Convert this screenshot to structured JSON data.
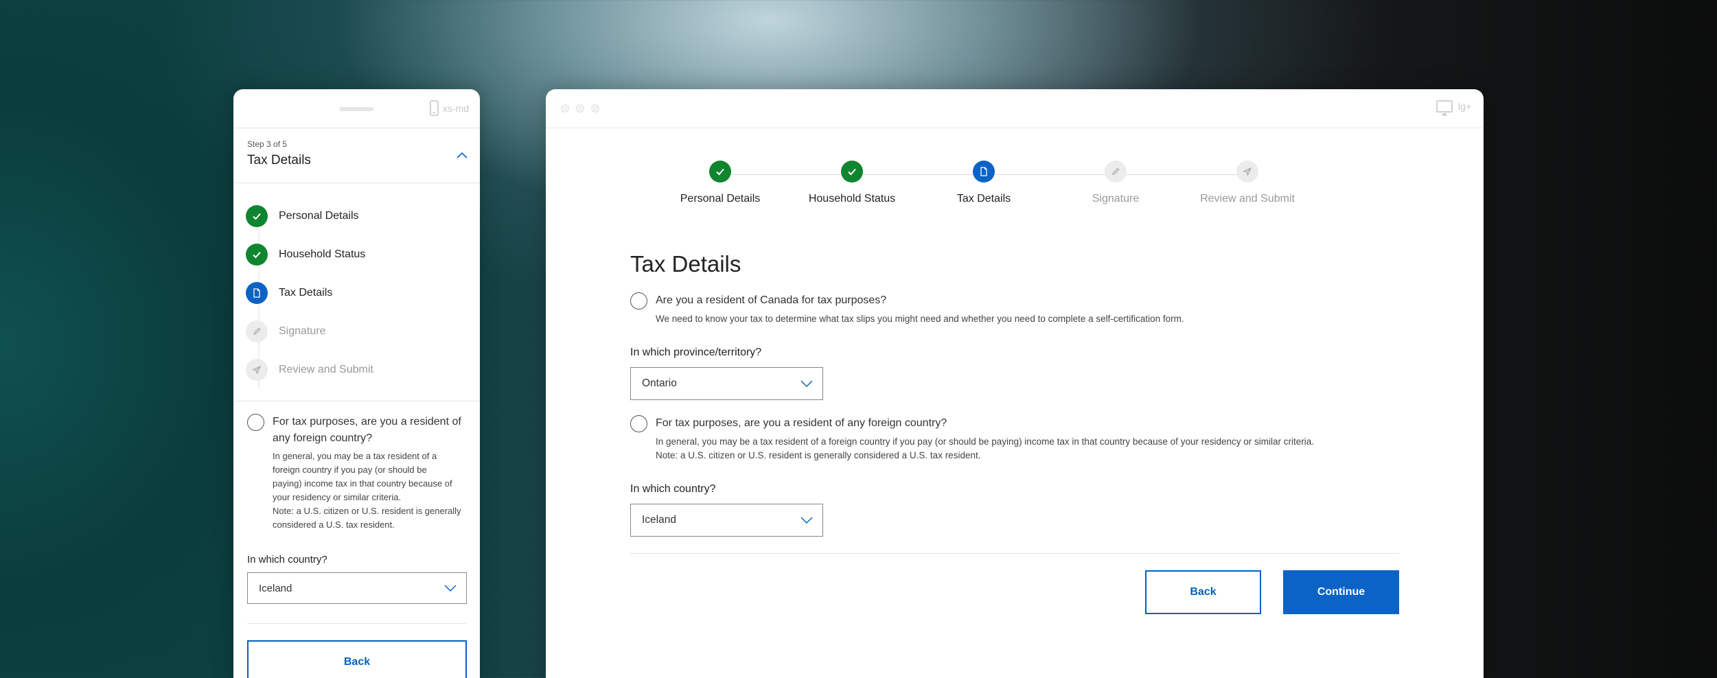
{
  "mobile": {
    "device_label": "xs-md",
    "step_counter": "Step 3 of 5",
    "step_title": "Tax Details",
    "steps": [
      {
        "label": "Personal Details",
        "status": "done"
      },
      {
        "label": "Household Status",
        "status": "done"
      },
      {
        "label": "Tax Details",
        "status": "current"
      },
      {
        "label": "Signature",
        "status": "todo"
      },
      {
        "label": "Review and Submit",
        "status": "todo"
      }
    ],
    "question": "For tax purposes, are you a resident of any foreign country?",
    "help_lines": [
      "In general, you may be a tax resident of a",
      "foreign country if you pay (or should be",
      "paying) income tax in that country because of",
      "your residency or similar criteria.",
      "Note: a U.S. citizen or U.S. resident is generally",
      "considered a U.S. tax resident."
    ],
    "country_label": "In which country?",
    "country_value": "Iceland",
    "back_label": "Back"
  },
  "desktop": {
    "device_label": "lg+",
    "steps": [
      {
        "label": "Personal Details",
        "status": "done"
      },
      {
        "label": "Household Status",
        "status": "done"
      },
      {
        "label": "Tax Details",
        "status": "current"
      },
      {
        "label": "Signature",
        "status": "todo"
      },
      {
        "label": "Review and Submit",
        "status": "todo"
      }
    ],
    "title": "Tax Details",
    "q1": "Are you a resident of Canada for tax purposes?",
    "q1_help": "We need to know your tax to determine what tax slips you might need and whether you need to complete a self-certification form.",
    "province_label": "In which province/territory?",
    "province_value": "Ontario",
    "q2": "For tax purposes, are you a resident of any foreign country?",
    "q2_help_1": "In general, you may be a tax resident of a foreign country if you pay (or should be paying) income tax in that country because of your residency or similar criteria.",
    "q2_help_2": "Note: a U.S. citizen or U.S. resident is generally considered a U.S. tax resident.",
    "country_label": "In which country?",
    "country_value": "Iceland",
    "back_label": "Back",
    "continue_label": "Continue"
  },
  "colors": {
    "done": "#10852f",
    "current": "#0b63c6",
    "todo": "#ececec",
    "accent": "#0062bf"
  },
  "icons": {
    "done": "checkmark-icon",
    "current": "document-icon",
    "signature": "pencil-icon",
    "review": "paper-plane-icon"
  }
}
